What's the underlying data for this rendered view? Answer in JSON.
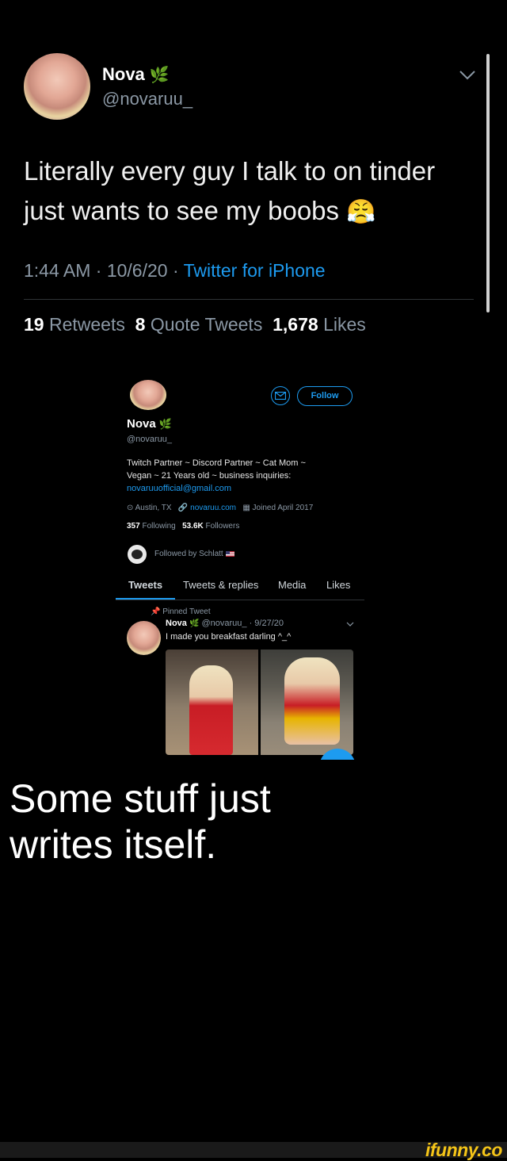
{
  "tweet": {
    "name": "Nova",
    "handle": "@novaruu_",
    "text_line1": "Literally every guy I talk to on tinder",
    "text_line2": "just wants to see my boobs",
    "emoji": "😤",
    "time": "1:44 AM · 10/6/20 · ",
    "source": "Twitter for iPhone",
    "retweets_count": "19",
    "retweets_label": "Retweets",
    "quotes_count": "8",
    "quotes_label": "Quote Tweets",
    "likes_count": "1,678",
    "likes_label": "Likes"
  },
  "profile": {
    "follow_label": "Follow",
    "name": "Nova",
    "handle": "@novaruu_",
    "bio_line1": "Twitch Partner ~ Discord Partner ~ Cat Mom ~",
    "bio_line2": "Vegan ~ 21 Years old ~ business inquiries:",
    "email": "novaruuofficial@gmail.com",
    "location": "Austin, TX",
    "website": "novaruu.com",
    "joined": "Joined April 2017",
    "following_count": "357",
    "following_label": "Following",
    "followers_count": "53.6K",
    "followers_label": "Followers",
    "followed_by": "Followed by Schlatt"
  },
  "tabs": [
    "Tweets",
    "Tweets & replies",
    "Media",
    "Likes"
  ],
  "pinned": {
    "label": "Pinned Tweet",
    "name": "Nova",
    "meta": "@novaruu_ · 9/27/20",
    "text": "I made you breakfast darling ^_^"
  },
  "caption": {
    "line1": "Some stuff just",
    "line2": "writes itself."
  },
  "watermark": "ifunny.co",
  "colors": {
    "accent": "#1d9bf0",
    "muted": "#8b98a5",
    "watermark": "#f5c518"
  }
}
